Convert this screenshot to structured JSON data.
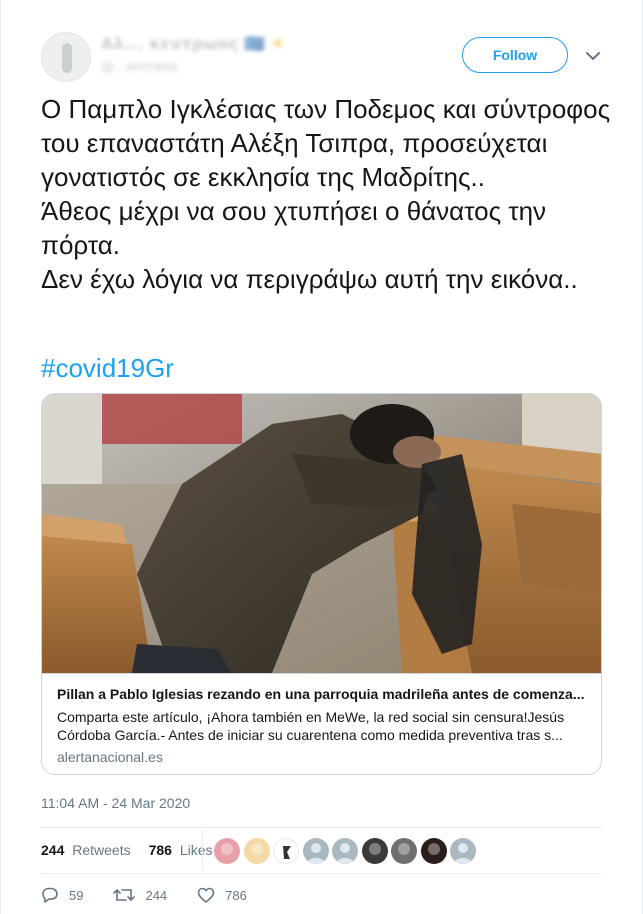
{
  "author": {
    "display_name": "Αλ... κεντρωος",
    "name_flag": "🇬🇷",
    "name_sun": "☀",
    "handle": "@...entrwos"
  },
  "follow_button": {
    "label": "Follow"
  },
  "tweet": {
    "text": "Ο Παμπλο Ιγκλέσιας των Ποδεμος και σύντροφος του επαναστάτη Αλέξη Τσιπρα, προσεύχεται γονατιστός σε εκκλησία της Μαδρίτης..\nΆθεος μέχρι να σου χτυπήσει ο θάνατος την πόρτα.\nΔεν έχω λόγια να περιγράψω αυτή την εικόνα..",
    "hashtag": "#covid19Gr"
  },
  "card": {
    "title": "Pillan a Pablo Iglesias rezando en una parroquia madrileña antes de comenza...",
    "description": "Comparta este artículo, ¡Ahora también en MeWe, la red social sin censura!Jesús Córdoba García.- Antes de iniciar su cuarentena como medida preventiva tras s...",
    "domain": "alertanacional.es"
  },
  "meta": {
    "timestamp": "11:04 AM - 24 Mar 2020"
  },
  "stats": {
    "retweets_count": "244",
    "retweets_label": "Retweets",
    "likes_count": "786",
    "likes_label": "Likes"
  },
  "likers": [
    {
      "name": "liker-avatar-1",
      "color": "#e8a0a8"
    },
    {
      "name": "liker-avatar-2",
      "color": "#f3d9a4"
    },
    {
      "name": "liker-avatar-3",
      "color": "#ffffff"
    },
    {
      "name": "liker-avatar-4",
      "color": "#aab8c2"
    },
    {
      "name": "liker-avatar-5",
      "color": "#aab8c2"
    },
    {
      "name": "liker-avatar-6",
      "color": "#3a3a3a"
    },
    {
      "name": "liker-avatar-7",
      "color": "#6d6f72"
    },
    {
      "name": "liker-avatar-8",
      "color": "#2b1e1a"
    },
    {
      "name": "liker-avatar-9",
      "color": "#aab8c2"
    }
  ],
  "actions": {
    "reply_count": "59",
    "retweet_count": "244",
    "like_count": "786"
  },
  "colors": {
    "accent": "#1da1f2",
    "text": "#14171a",
    "muted": "#657786",
    "border": "#ccd6dd"
  },
  "icons": {
    "reply": "reply-icon",
    "retweet": "retweet-icon",
    "like": "heart-icon",
    "more": "chevron-down-icon"
  }
}
